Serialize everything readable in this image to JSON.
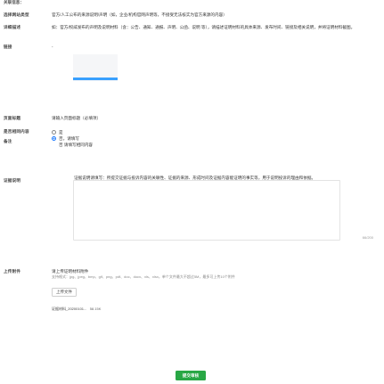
{
  "header": {
    "title": "关联信息："
  },
  "form": {
    "site_type": {
      "label": "选择网站类型",
      "value": "官方/人工公布的来源说明/声明（如，企业/机构官网声明等，不接受无法核实为官方来源的内容）"
    },
    "description": {
      "label": "详细描述",
      "value": "如：官方/权威发布的声明及说明材料（含：公告、通知、通报、声明、公函、说明 等），请描述证明材料的具体来源、发布时间、链接及相关说明，并将证明材料截图。"
    },
    "link": {
      "label": "链接",
      "value": "-"
    },
    "page_title": {
      "label": "页面标题",
      "value": "请输入页面标题（必填项）"
    },
    "same_content": {
      "label": "是否相同内容",
      "options": [
        "是",
        "否，请填写"
      ],
      "selected_index": 0,
      "follow_text": "否 请填写相同内容"
    },
    "note": {
      "label": "备注",
      "value": ""
    },
    "evidence": {
      "label": "证据说明",
      "value": "证据说明请填写：所提交证据与投诉内容的关联性、证据的来源、形成时间及证据内容能证明的事实等，用于说明投诉的理由和依据。",
      "counter": "66/200"
    },
    "attachments": {
      "label": "上传附件",
      "title": "请上传证明材料附件",
      "hint": "支持格式：jpg、jpeg、bmp、gif、png、pdf、doc、docx、xls、xlsx，单个文件最大不超过5M，最多可上传10个附件",
      "upload_label": "上传文件",
      "file_name": "证据材料_20200101...",
      "file_size": "58.15K"
    }
  },
  "submit_label": "提交审核",
  "colors": {
    "accent": "#1677ff",
    "submit": "#28a745",
    "required": "#e23"
  }
}
